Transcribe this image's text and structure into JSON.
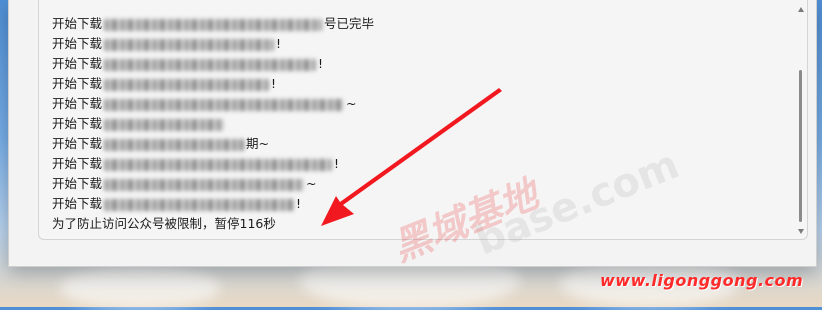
{
  "log": {
    "prefix": "开始下载",
    "lines": [
      {
        "tail": "号已完毕"
      },
      {
        "tail": "!"
      },
      {
        "tail": "!"
      },
      {
        "tail": "!"
      },
      {
        "tail": "~"
      },
      {
        "tail": ""
      },
      {
        "tail": "期~"
      },
      {
        "tail": "!"
      },
      {
        "tail": "~"
      },
      {
        "tail": "!"
      }
    ],
    "status_line": "为了防止访问公众号被限制，暂停116秒"
  },
  "watermark": {
    "url": "www.ligonggong.com",
    "stamp_text": "黑域基地",
    "faint_text": "base.com"
  },
  "colors": {
    "arrow": "#f2181f",
    "watermark": "#ff2a2a"
  }
}
